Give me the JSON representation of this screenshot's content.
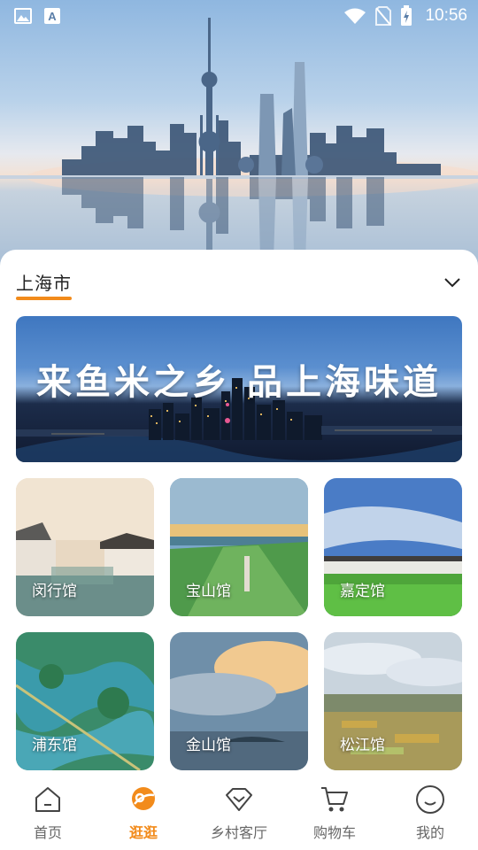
{
  "status_bar": {
    "time": "10:56",
    "icons": [
      "gallery-icon",
      "font-icon",
      "wifi-icon",
      "no-sim-icon",
      "battery-icon"
    ]
  },
  "city_selector": {
    "city": "上海市"
  },
  "banner": {
    "text": "来鱼米之乡  品上海味道"
  },
  "pavilions": [
    {
      "label": "闵行馆"
    },
    {
      "label": "宝山馆"
    },
    {
      "label": "嘉定馆"
    },
    {
      "label": "浦东馆"
    },
    {
      "label": "金山馆"
    },
    {
      "label": "松江馆"
    }
  ],
  "tabs": [
    {
      "label": "首页",
      "icon": "home-icon"
    },
    {
      "label": "逛逛",
      "icon": "browse-icon",
      "active": true
    },
    {
      "label": "乡村客厅",
      "icon": "diamond-icon"
    },
    {
      "label": "购物车",
      "icon": "cart-icon"
    },
    {
      "label": "我的",
      "icon": "profile-icon"
    }
  ],
  "colors": {
    "accent": "#f28b1b",
    "tab_inactive": "#666666"
  }
}
